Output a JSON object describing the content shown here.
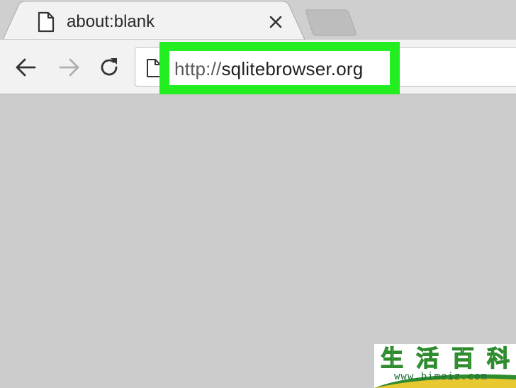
{
  "tab": {
    "title": "about:blank",
    "page_icon": "page-icon",
    "close_icon": "close-icon"
  },
  "new_tab": {
    "icon": "new-tab-icon"
  },
  "toolbar": {
    "back_icon": "back-arrow-icon",
    "forward_icon": "forward-arrow-icon",
    "reload_icon": "reload-icon"
  },
  "omnibox": {
    "url_scheme": "http://",
    "url_host": "sqlitebrowser.org",
    "highlight_color": "#22ee22"
  },
  "watermark": {
    "chars": [
      "生",
      "活",
      "百",
      "科"
    ],
    "url": "www.bimeiz.com"
  }
}
